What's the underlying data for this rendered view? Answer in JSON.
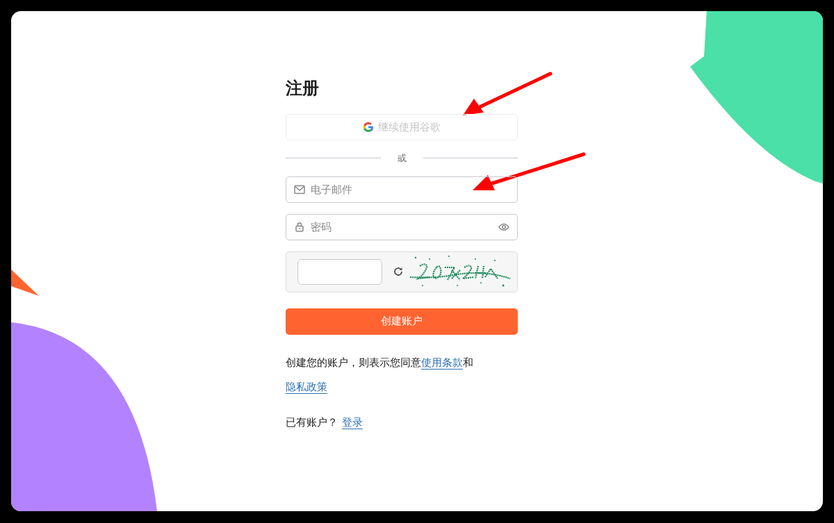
{
  "title": "注册",
  "google_button": {
    "label": "继续使用谷歌",
    "disabled": true
  },
  "divider_text": "或",
  "email_field": {
    "placeholder": "电子邮件"
  },
  "password_field": {
    "placeholder": "密码"
  },
  "submit_button": {
    "label": "创建账户"
  },
  "terms": {
    "text_before": "创建您的账户，则表示您同意",
    "terms_link": "使用条款",
    "text_between": "和",
    "privacy_link": "隐私政策"
  },
  "login_prompt": {
    "text": "已有账户？",
    "link": "登录"
  }
}
